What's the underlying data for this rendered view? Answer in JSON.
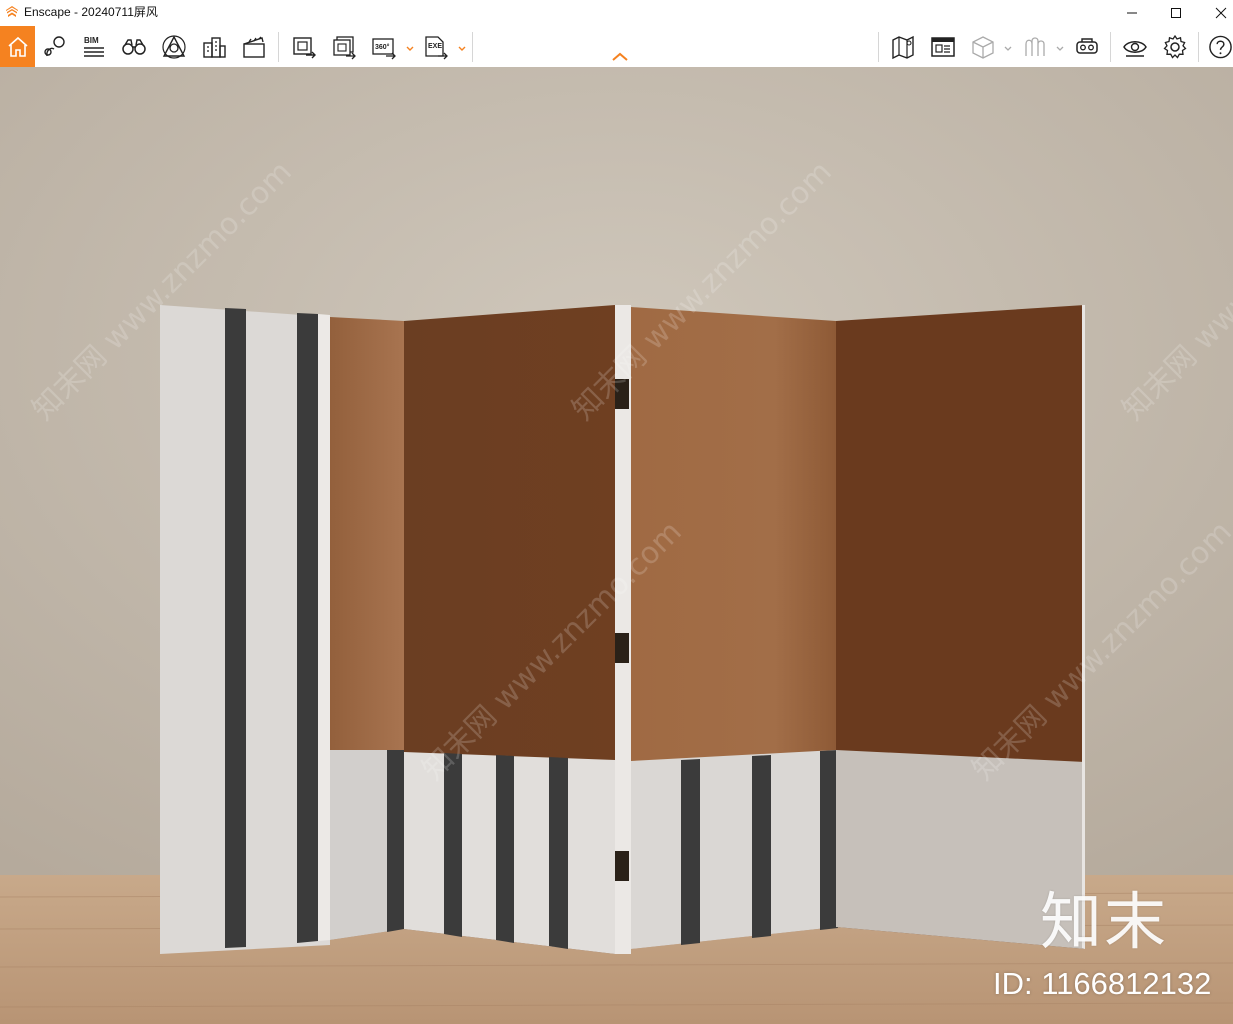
{
  "window": {
    "title": "Enscape - 20240711屏风",
    "controls": [
      "minimize",
      "maximize",
      "close"
    ]
  },
  "toolbar": {
    "left_icons": [
      {
        "name": "home-icon",
        "active": true
      },
      {
        "name": "view-management-icon"
      },
      {
        "name": "bim-icon",
        "label": "BIM"
      },
      {
        "name": "binoculars-icon"
      },
      {
        "name": "atmosphere-icon"
      },
      {
        "name": "buildings-icon"
      },
      {
        "name": "clapperboard-icon"
      },
      {
        "name": "screenshot-icon"
      },
      {
        "name": "batch-render-icon"
      },
      {
        "name": "panorama-360-icon",
        "label": "360°"
      },
      {
        "name": "export-exe-icon",
        "label": "EXE"
      }
    ],
    "right_icons": [
      {
        "name": "map-icon"
      },
      {
        "name": "asset-library-icon"
      },
      {
        "name": "cube-icon"
      },
      {
        "name": "materials-icon"
      },
      {
        "name": "vr-headset-icon"
      },
      {
        "name": "visibility-icon"
      },
      {
        "name": "settings-icon"
      },
      {
        "name": "help-icon"
      }
    ],
    "accent_color": "#f58220"
  },
  "viewport": {
    "watermark_logo": "知末",
    "watermark_id": "ID: 1166812132",
    "diagonal_watermark": "知末网 www.znzmo.com"
  }
}
